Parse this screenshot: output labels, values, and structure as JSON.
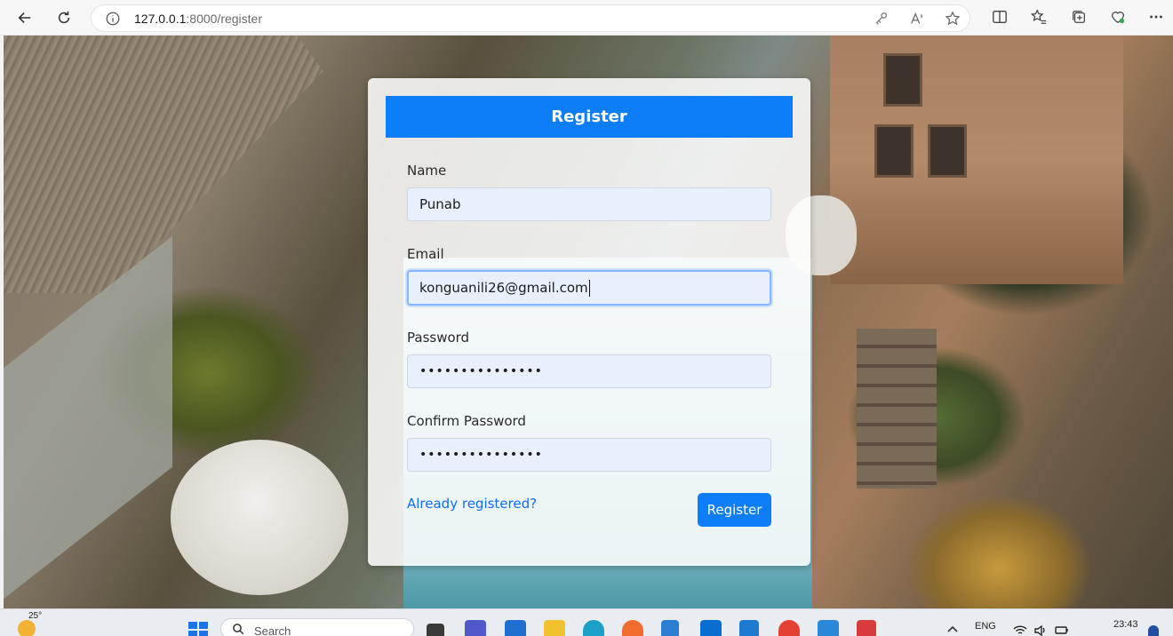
{
  "browser": {
    "url_host": "127.0.0.1",
    "url_rest": ":8000/register"
  },
  "form": {
    "title": "Register",
    "name_label": "Name",
    "name_value": "Punab",
    "email_label": "Email",
    "email_value": "konguanili26@gmail.com",
    "password_label": "Password",
    "password_value": "•••••••••••••••",
    "confirm_label": "Confirm Password",
    "confirm_value": "•••••••••••••••",
    "login_link": "Already registered?",
    "submit_label": "Register"
  },
  "taskbar": {
    "temperature": "25°",
    "search_placeholder": "Search",
    "language": "ENG",
    "time": "23:43"
  },
  "colors": {
    "primary": "#0d7df8",
    "link": "#0d6efd",
    "input_bg": "#e8f0fe"
  }
}
